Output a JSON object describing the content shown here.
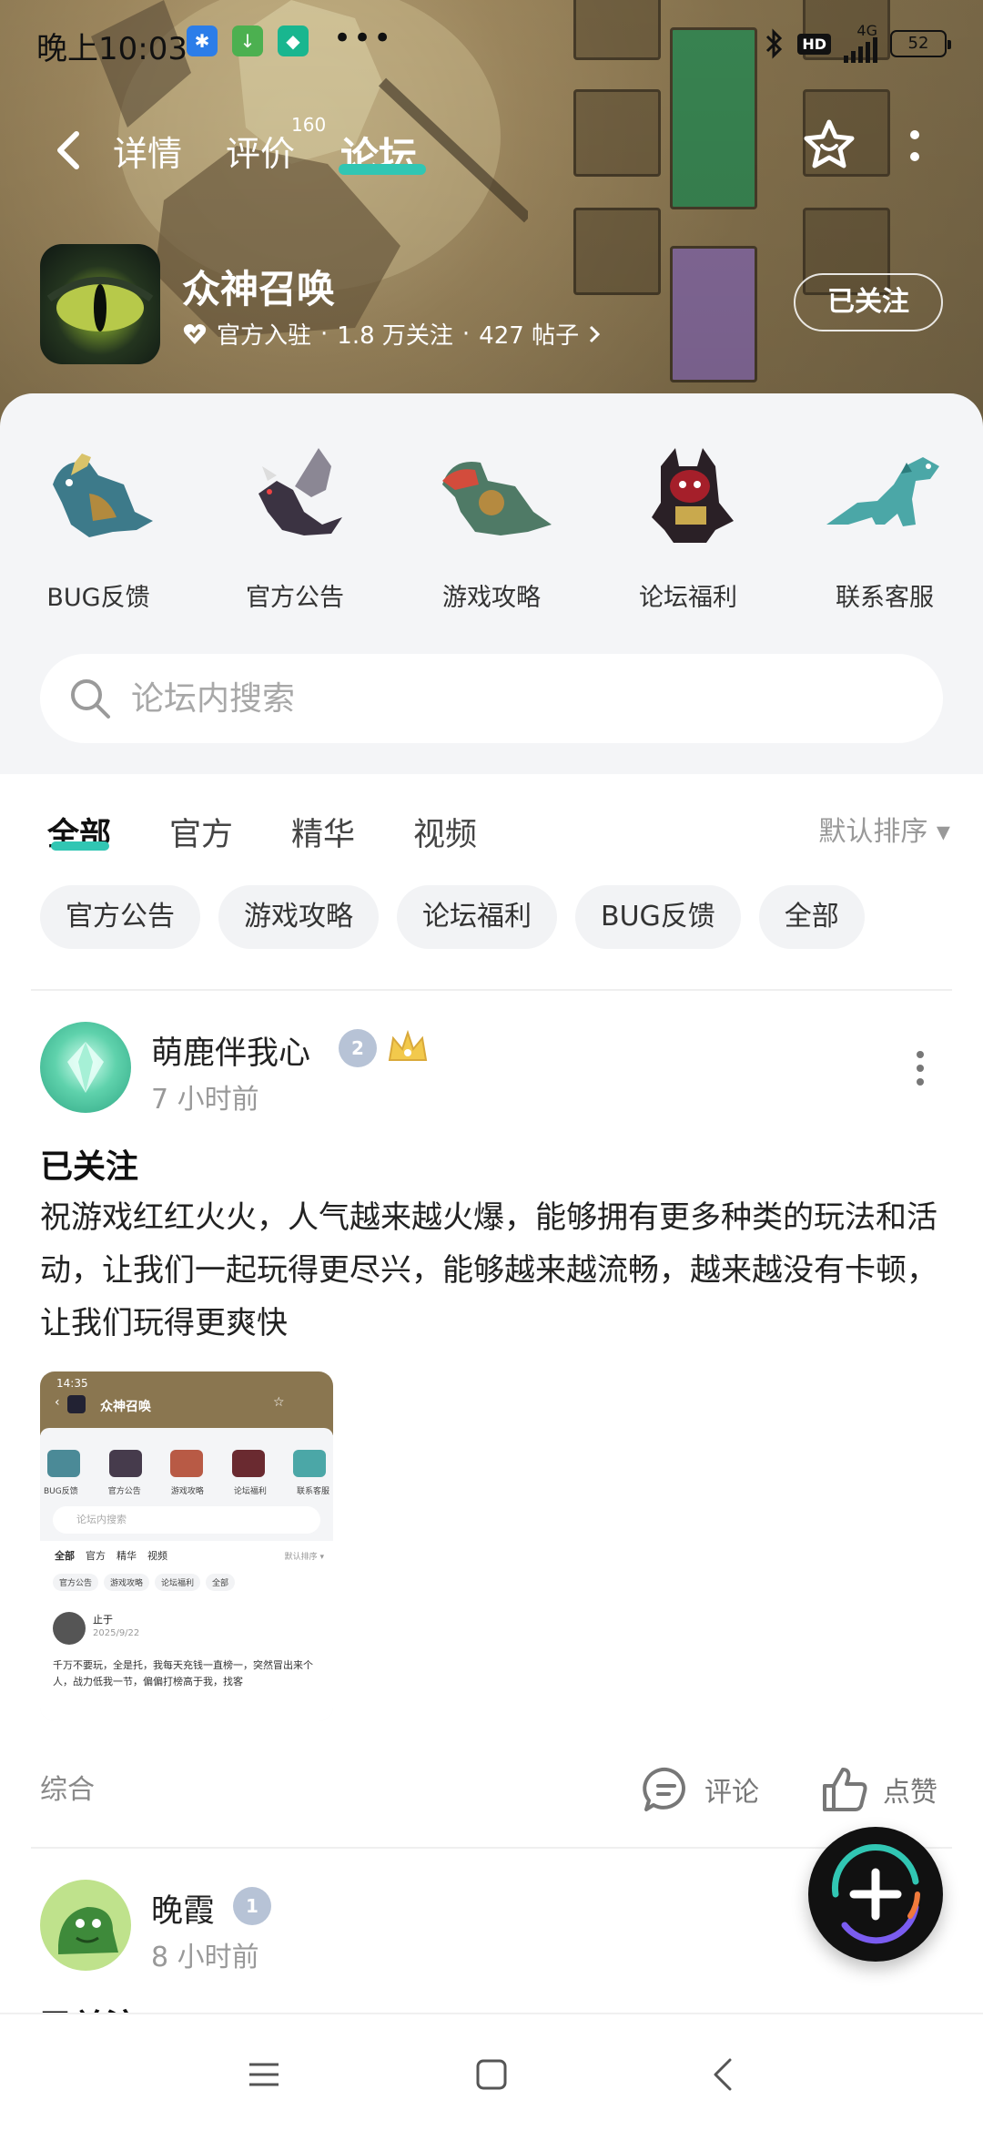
{
  "status_bar": {
    "time": "晚上10:03",
    "more": "•••",
    "network": "4G",
    "hd": "HD",
    "battery": "52"
  },
  "nav": {
    "tabs": [
      {
        "label": "详情"
      },
      {
        "label": "评价"
      },
      {
        "label": "论坛"
      }
    ],
    "rating_count": "160",
    "active_tab": "论坛"
  },
  "game": {
    "name": "众神召唤",
    "verified": "官方入驻",
    "followers": "1.8 万关注",
    "posts": "427 帖子",
    "sep": "·",
    "follow_state": "已关注"
  },
  "categories": [
    {
      "label": "BUG反馈",
      "icon": "blue-dragon-icon"
    },
    {
      "label": "官方公告",
      "icon": "winged-dragon-icon"
    },
    {
      "label": "游戏攻略",
      "icon": "red-dragon-icon"
    },
    {
      "label": "论坛福利",
      "icon": "horned-demon-icon"
    },
    {
      "label": "联系客服",
      "icon": "teal-dinosaur-icon"
    }
  ],
  "search": {
    "placeholder": "论坛内搜索"
  },
  "filter_tabs": [
    {
      "label": "全部"
    },
    {
      "label": "官方"
    },
    {
      "label": "精华"
    },
    {
      "label": "视频"
    }
  ],
  "sort": {
    "label": "默认排序 ▾"
  },
  "chips": [
    {
      "label": "官方公告"
    },
    {
      "label": "游戏攻略"
    },
    {
      "label": "论坛福利"
    },
    {
      "label": "BUG反馈"
    },
    {
      "label": "全部"
    }
  ],
  "posts": [
    {
      "user": "萌鹿伴我心",
      "level": "2",
      "time": "7 小时前",
      "title": "已关注",
      "body": "祝游戏红红火火，人气越来越火爆，能够拥有更多种类的玩法和活动，让我们一起玩得更尽兴，能够越来越流畅，越来越没有卡顿，让我们玩得更爽快",
      "tag": "综合",
      "comment_label": "评论",
      "like_label": "点赞",
      "thumbnail": {
        "status_time": "14:35",
        "title": "众神召唤",
        "cats": [
          "BUG反馈",
          "官方公告",
          "游戏攻略",
          "论坛福利",
          "联系客服"
        ],
        "search": "论坛内搜索",
        "tabs": [
          "全部",
          "官方",
          "精华",
          "视频"
        ],
        "sort": "默认排序 ▾",
        "chips": [
          "官方公告",
          "游戏攻略",
          "论坛福利",
          "全部"
        ],
        "user": "止于",
        "date": "2025/9/22",
        "text": "千万不要玩，全是托，我每天充钱一直榜一，突然冒出来个人，战力低我一节，偏偏打榜高于我，找客"
      }
    },
    {
      "user": "晚霞",
      "level": "1",
      "time": "8 小时前",
      "title": "已关注"
    }
  ],
  "colors": {
    "accent": "#31c6b3",
    "banner": "#8a7650",
    "panel": "#f4f5f7"
  }
}
